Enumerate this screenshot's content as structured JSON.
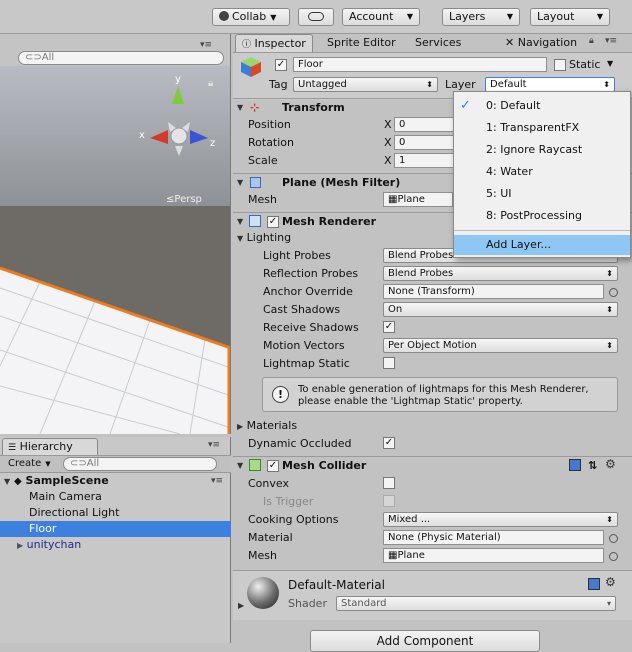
{
  "toolbar": {
    "collab": "Collab",
    "account": "Account",
    "layers": "Layers",
    "layout": "Layout"
  },
  "scene": {
    "search_placeholder": "All",
    "persp": "Persp",
    "axis_y": "y",
    "axis_x": "x",
    "axis_z": "z"
  },
  "hierarchy": {
    "tab": "Hierarchy",
    "create": "Create",
    "search_placeholder": "All",
    "scene_name": "SampleScene",
    "items": [
      "Main Camera",
      "Directional Light",
      "Floor",
      "unitychan"
    ]
  },
  "inspector": {
    "tabs": [
      "Inspector",
      "Sprite Editor",
      "Services",
      "Navigation"
    ],
    "object_name": "Floor",
    "static_label": "Static",
    "tag_label": "Tag",
    "tag_value": "Untagged",
    "layer_label": "Layer",
    "layer_value": "Default",
    "transform": {
      "title": "Transform",
      "position": "Position",
      "rotation": "Rotation",
      "scale": "Scale",
      "x": "X",
      "pos_x": "0",
      "rot_x": "0",
      "scale_x": "1"
    },
    "mesh_filter": {
      "title": "Plane (Mesh Filter)",
      "mesh_label": "Mesh",
      "mesh_value": "Plane"
    },
    "mesh_renderer": {
      "title": "Mesh Renderer",
      "lighting": "Lighting",
      "light_probes": "Light Probes",
      "light_probes_val": "Blend Probes",
      "reflection_probes": "Reflection Probes",
      "reflection_probes_val": "Blend Probes",
      "anchor_override": "Anchor Override",
      "anchor_override_val": "None (Transform)",
      "cast_shadows": "Cast Shadows",
      "cast_shadows_val": "On",
      "receive_shadows": "Receive Shadows",
      "motion_vectors": "Motion Vectors",
      "motion_vectors_val": "Per Object Motion",
      "lightmap_static": "Lightmap Static",
      "help_line1": "To enable generation of lightmaps for this Mesh Renderer,",
      "help_line2": "please enable the 'Lightmap Static' property.",
      "materials": "Materials",
      "dynamic_occluded": "Dynamic Occluded"
    },
    "mesh_collider": {
      "title": "Mesh Collider",
      "convex": "Convex",
      "is_trigger": "Is Trigger",
      "cooking_options": "Cooking Options",
      "cooking_options_val": "Mixed ...",
      "material": "Material",
      "material_val": "None (Physic Material)",
      "mesh": "Mesh",
      "mesh_val": "Plane"
    },
    "material": {
      "name": "Default-Material",
      "shader_label": "Shader",
      "shader_val": "Standard"
    },
    "add_component": "Add Component"
  },
  "layer_menu": {
    "items": [
      "0: Default",
      "1: TransparentFX",
      "2: Ignore Raycast",
      "4: Water",
      "5: UI",
      "8: PostProcessing"
    ],
    "add_layer": "Add Layer...",
    "checked": "✓"
  },
  "colors": {
    "selection": "#3d80df",
    "menu_highlight": "#8ec7f4",
    "plane_outline": "#f07b1e"
  }
}
